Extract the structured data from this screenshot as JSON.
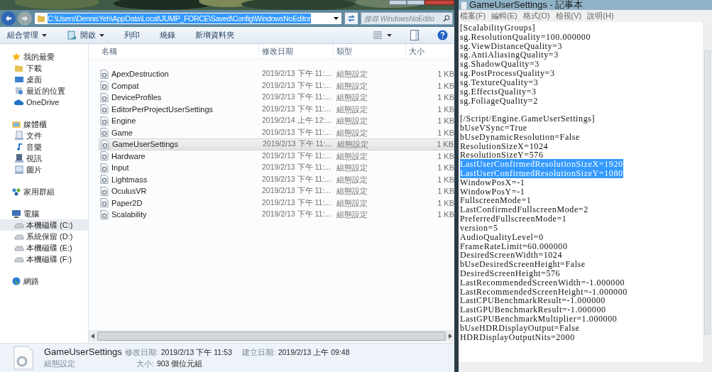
{
  "explorer": {
    "path": "C:\\Users\\DennisYeh\\AppData\\Local\\JUMP_FORCE\\Saved\\Config\\WindowsNoEditor",
    "path_selected": true,
    "search": {
      "placeholder": "搜尋 WindowsNoEdito"
    },
    "toolbar": [
      {
        "label": "組合管理",
        "dropdown": true,
        "kind": "text"
      },
      {
        "label": "開啟",
        "dropdown": true,
        "kind": "open"
      },
      {
        "label": "列印",
        "dropdown": false,
        "kind": "text"
      },
      {
        "label": "燒錄",
        "dropdown": false,
        "kind": "text"
      },
      {
        "label": "新增資料夾",
        "dropdown": false,
        "kind": "text"
      }
    ],
    "sidebar": [
      {
        "label": "我的最愛",
        "kind": "star",
        "children": [
          {
            "label": "下載",
            "kind": "folder",
            "selected": false
          },
          {
            "label": "桌面",
            "kind": "desktop",
            "selected": false
          },
          {
            "label": "最近的位置",
            "kind": "recent",
            "selected": false
          },
          {
            "label": "OneDrive",
            "kind": "cloud",
            "selected": false
          }
        ]
      },
      {
        "label": "媒體櫃",
        "kind": "library",
        "children": [
          {
            "label": "文件",
            "kind": "doc",
            "selected": false
          },
          {
            "label": "音樂",
            "kind": "music",
            "selected": false
          },
          {
            "label": "視訊",
            "kind": "video",
            "selected": false
          },
          {
            "label": "圖片",
            "selected": false
          }
        ]
      },
      {
        "label": "家用群組",
        "kind": "homegroup"
      },
      {
        "label": "電腦",
        "kind": "computer",
        "children": [
          {
            "label": "本機磁碟 (C:)",
            "kind": "drive",
            "selected": true
          },
          {
            "label": "系統保留 (D:)",
            "kind": "drive",
            "selected": false
          },
          {
            "label": "本機磁碟 (E:)",
            "kind": "drive",
            "selected": false
          },
          {
            "label": "本機磁碟 (F:)",
            "kind": "drive",
            "selected": false
          }
        ]
      },
      {
        "label": "網路",
        "kind": "network"
      }
    ],
    "columns": [
      "名稱",
      "修改日期",
      "類型",
      "大小"
    ],
    "files": [
      {
        "name": "ApexDestruction",
        "date": "2019/2/13 下午 11:...",
        "type": "組態設定",
        "size": "1 KB",
        "selected": false
      },
      {
        "name": "Compat",
        "date": "2019/2/13 下午 11:...",
        "type": "組態設定",
        "size": "1 KB",
        "selected": false
      },
      {
        "name": "DeviceProfiles",
        "date": "2019/2/13 下午 11:...",
        "type": "組態設定",
        "size": "1 KB",
        "selected": false
      },
      {
        "name": "EditorPerProjectUserSettings",
        "date": "2019/2/13 下午 11:...",
        "type": "組態設定",
        "size": "1 KB",
        "selected": false
      },
      {
        "name": "Engine",
        "date": "2019/2/14 上午 12:...",
        "type": "組態設定",
        "size": "1 KB",
        "selected": false
      },
      {
        "name": "Game",
        "date": "2019/2/13 下午 11:...",
        "type": "組態設定",
        "size": "1 KB",
        "selected": false
      },
      {
        "name": "GameUserSettings",
        "date": "2019/2/13 下午 11:...",
        "type": "組態設定",
        "size": "1 KB",
        "selected": true
      },
      {
        "name": "Hardware",
        "date": "2019/2/13 下午 11:...",
        "type": "組態設定",
        "size": "1 KB",
        "selected": false
      },
      {
        "name": "Input",
        "date": "2019/2/13 下午 11:...",
        "type": "組態設定",
        "size": "1 KB",
        "selected": false
      },
      {
        "name": "Lightmass",
        "date": "2019/2/13 下午 11:...",
        "type": "組態設定",
        "size": "1 KB",
        "selected": false
      },
      {
        "name": "OculusVR",
        "date": "2019/2/13 下午 11:...",
        "type": "組態設定",
        "size": "1 KB",
        "selected": false
      },
      {
        "name": "Paper2D",
        "date": "2019/2/13 下午 11:...",
        "type": "組態設定",
        "size": "1 KB",
        "selected": false
      },
      {
        "name": "Scalability",
        "date": "2019/2/13 下午 11:...",
        "type": "組態設定",
        "size": "1 KB",
        "selected": false
      }
    ],
    "details": {
      "name": "GameUserSettings",
      "type": "組態設定",
      "modified_label": "修改日期:",
      "modified": "2019/2/13 下午 11:53",
      "created_label": "建立日期:",
      "created": "2019/2/13 上午 09:48",
      "size_label": "大小:",
      "size": "903 個位元組"
    }
  },
  "notepad": {
    "title": "GameUserSettings - 記事本",
    "menu": [
      "檔案(F)",
      "編輯(E)",
      "格式(O)",
      "檢視(V)",
      "說明(H)"
    ],
    "sections": [
      [
        {
          "text": "[ScalabilityGroups]",
          "selected": false
        },
        {
          "text": "sg.ResolutionQuality=100.000000",
          "selected": false
        },
        {
          "text": "sg.ViewDistanceQuality=3",
          "selected": false
        },
        {
          "text": "sg.AntiAliasingQuality=3",
          "selected": false
        },
        {
          "text": "sg.ShadowQuality=3",
          "selected": false
        },
        {
          "text": "sg.PostProcessQuality=3",
          "selected": false
        },
        {
          "text": "sg.TextureQuality=3",
          "selected": false
        },
        {
          "text": "sg.EffectsQuality=3",
          "selected": false
        },
        {
          "text": "sg.FoliageQuality=2",
          "selected": false
        }
      ],
      [
        {
          "text": "[/Script/Engine.GameUserSettings]",
          "selected": false
        },
        {
          "text": "bUseVSync=True",
          "selected": false
        },
        {
          "text": "bUseDynamicResolution=False",
          "selected": false
        },
        {
          "text": "ResolutionSizeX=1024",
          "selected": false
        },
        {
          "text": "ResolutionSizeY=576",
          "selected": false
        },
        {
          "text": "LastUserConfirmedResolutionSizeX=1920",
          "selected": true
        },
        {
          "text": "LastUserConfirmedResolutionSizeY=1080",
          "selected": true
        },
        {
          "text": "WindowPosX=-1",
          "selected": false
        },
        {
          "text": "WindowPosY=-1",
          "selected": false
        },
        {
          "text": "FullscreenMode=1",
          "selected": false
        },
        {
          "text": "LastConfirmedFullscreenMode=2",
          "selected": false
        },
        {
          "text": "PreferredFullscreenMode=1",
          "selected": false
        },
        {
          "text": "version=5",
          "selected": false
        },
        {
          "text": "AudioQualityLevel=0",
          "selected": false
        },
        {
          "text": "FrameRateLimit=60.000000",
          "selected": false
        },
        {
          "text": "DesiredScreenWidth=1024",
          "selected": false
        },
        {
          "text": "bUseDesiredScreenHeight=False",
          "selected": false
        },
        {
          "text": "DesiredScreenHeight=576",
          "selected": false
        },
        {
          "text": "LastRecommendedScreenWidth=-1.000000",
          "selected": false
        },
        {
          "text": "LastRecommendedScreenHeight=-1.000000",
          "selected": false
        },
        {
          "text": "LastCPUBenchmarkResult=-1.000000",
          "selected": false
        },
        {
          "text": "LastGPUBenchmarkResult=-1.000000",
          "selected": false
        },
        {
          "text": "LastGPUBenchmarkMultiplier=1.000000",
          "selected": false
        },
        {
          "text": "bUseHDRDisplayOutput=False",
          "selected": false
        },
        {
          "text": "HDRDisplayOutputNits=2000",
          "selected": false
        }
      ]
    ]
  }
}
